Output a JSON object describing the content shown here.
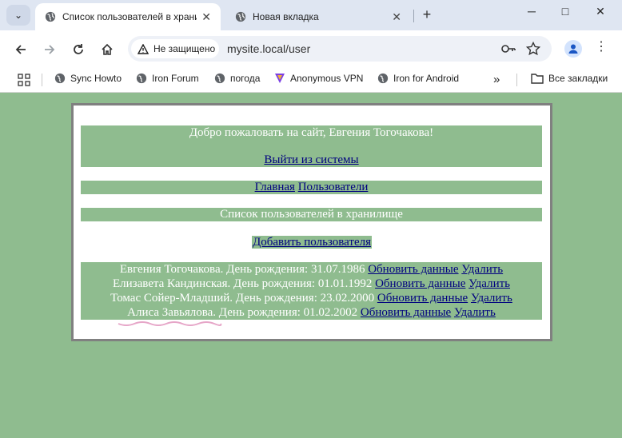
{
  "browser": {
    "tabs": [
      {
        "title": "Список пользователей в храни",
        "active": true
      },
      {
        "title": "Новая вкладка",
        "active": false
      }
    ],
    "address": {
      "security_label": "Не защищено",
      "url": "mysite.local/user"
    },
    "bookmarks": [
      {
        "label": "Sync Howto",
        "icon": "globe-icon"
      },
      {
        "label": "Iron Forum",
        "icon": "globe-icon"
      },
      {
        "label": "погода",
        "icon": "globe-icon"
      },
      {
        "label": "Anonymous VPN",
        "icon": "vpn-icon"
      },
      {
        "label": "Iron for Android",
        "icon": "globe-icon"
      }
    ],
    "all_bookmarks_label": "Все закладки"
  },
  "page": {
    "welcome": "Добро пожаловать на сайт, Евгения Тогочакова!",
    "logout": "Выйти из системы",
    "nav": {
      "home": "Главная",
      "users": "Пользователи"
    },
    "heading": "Список пользователей в хранилище",
    "add_user": "Добавить пользователя",
    "users": [
      {
        "text": "Евгения Тогочакова. День рождения: 31.07.1986",
        "update": "Обновить данные",
        "delete": "Удалить"
      },
      {
        "text": "Елизавета Кандинская. День рождения: 01.01.1992",
        "update": "Обновить данные",
        "delete": "Удалить"
      },
      {
        "text": "Томас Сойер-Младший. День рождения: 23.02.2000",
        "update": "Обновить данные",
        "delete": "Удалить"
      },
      {
        "text": "Алиса Завьялова. День рождения: 01.02.2002",
        "update": "Обновить данные",
        "delete": "Удалить"
      }
    ]
  },
  "colors": {
    "page_bg": "#8fbc8f",
    "link": "#000080",
    "box_border": "#808080"
  }
}
